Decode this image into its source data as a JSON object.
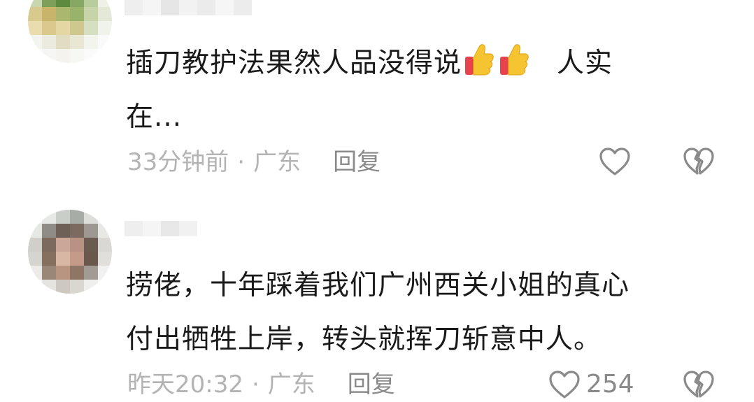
{
  "comments": [
    {
      "text_line1": "插刀教护法果然人品没得说",
      "text_after_emoji": "人实",
      "text_line2": "在...",
      "emoji": [
        "thumbs-up-icon",
        "thumbs-up-icon"
      ],
      "time": "33分钟前",
      "dot": "·",
      "location": "广东",
      "reply_label": "回复",
      "like_count": ""
    },
    {
      "text_line1": "捞佬，十年踩着我们广州西关小姐的真心",
      "text_line2": "付出牺牲上岸，转头就挥刀斩意中人。",
      "time": "昨天20:32",
      "dot": "·",
      "location": "广东",
      "reply_label": "回复",
      "like_count": "254"
    }
  ],
  "colors": {
    "text": "#1a1a1a",
    "meta": "#b3b3b3",
    "action": "#8a8a8a",
    "thumb": "#f7c431",
    "thumb_cuff": "#e8434c"
  }
}
